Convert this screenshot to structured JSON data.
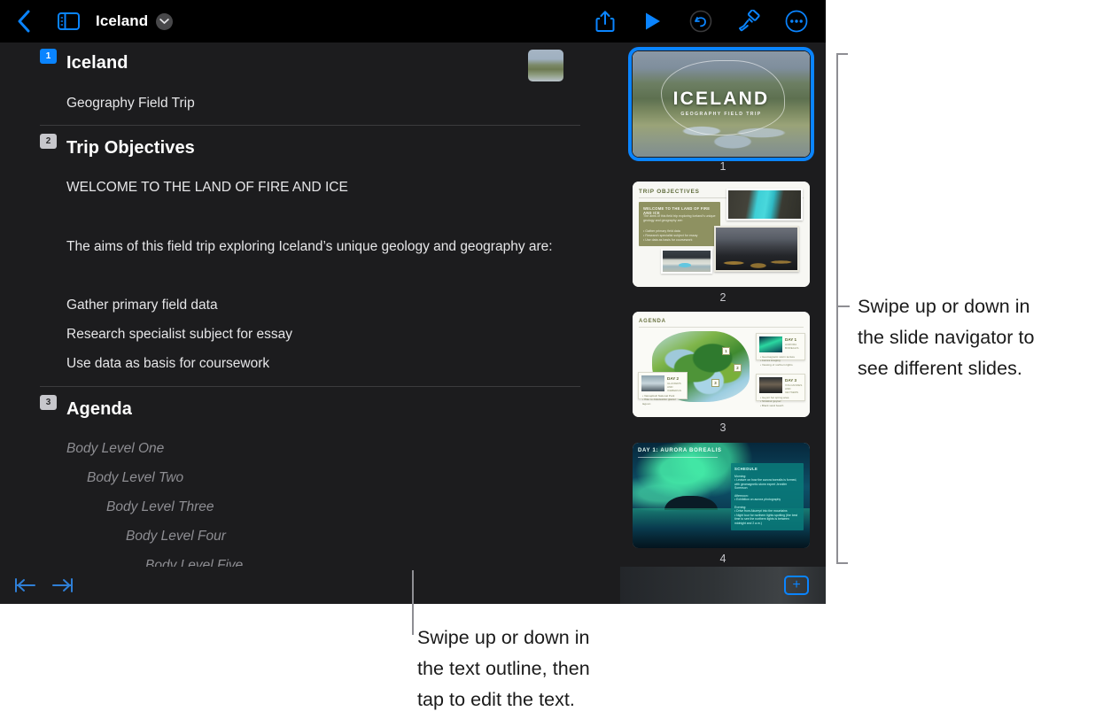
{
  "app": {
    "title": "Iceland",
    "toolbar": {
      "back": "back-chevron",
      "sidebar_toggle": "sidebar-icon",
      "title_menu": "chevron-down-icon",
      "share": "share-icon",
      "play": "play-icon",
      "undo": "undo-icon",
      "format": "paintbrush-icon",
      "more": "more-ellipsis-icon"
    }
  },
  "outline": {
    "slides": [
      {
        "number": "1",
        "selected": true,
        "title": "Iceland",
        "body": [
          "Geography Field Trip"
        ],
        "has_thumbnail": true
      },
      {
        "number": "2",
        "selected": false,
        "title": "Trip Objectives",
        "body": [
          "WELCOME TO THE LAND OF FIRE AND ICE",
          "The aims of this field trip exploring Iceland’s unique geology and geography are:",
          "Gather primary field data",
          "Research specialist subject for essay",
          "Use data as basis for coursework"
        ],
        "has_thumbnail": false
      },
      {
        "number": "3",
        "selected": false,
        "title": "Agenda",
        "placeholders": [
          "Body Level One",
          "Body Level Two",
          "Body Level Three",
          "Body Level Four",
          "Body Level Five"
        ],
        "has_thumbnail": false
      }
    ]
  },
  "navigator": {
    "slides": [
      {
        "number": "1",
        "selected": true,
        "title": "ICELAND",
        "subtitle": "GEOGRAPHY FIELD TRIP"
      },
      {
        "number": "2",
        "selected": false,
        "title": "TRIP OBJECTIVES",
        "block_title": "WELCOME TO THE LAND OF FIRE AND ICE",
        "block_para": "The aims of this field trip exploring Iceland’s unique geology and geography are:",
        "block_list": "• Gather primary field data\n• Research specialist subject for essay\n• Use data as basis for coursework"
      },
      {
        "number": "3",
        "selected": false,
        "title": "AGENDA",
        "pins": [
          "1",
          "2",
          "3"
        ],
        "cards": [
          {
            "day": "DAY 1",
            "sub": "AURORA BOREALIS",
            "list": "• Geomagnetic storm lecture\n• Aurora imaging\n• Viewing of northern lights"
          },
          {
            "day": "DAY 2",
            "sub": "GLACIERS AND ICEBERGS",
            "list": "• Vatnajökull National Park\n• Hike to Jökulsárlón glacier lagoon"
          },
          {
            "day": "DAY 3",
            "sub": "VOLCANOES AND GEYSERS",
            "list": "• Geysir hot spring area\n• Strokkur geyser\n• Black sand beach"
          }
        ]
      },
      {
        "number": "4",
        "selected": false,
        "title": "DAY 1: AURORA BOREALIS",
        "schedule_title": "SCHEDULE",
        "schedule_morning": "Morning:\n• Lecture on how the aurora borealis is formed, with geomagnetic storm expert Jennifer Sorenson",
        "schedule_afternoon": "Afternoon:\n• Exhibition on aurora photography",
        "schedule_evening": "Evening:\n• Drive from Akureyri into the mountains\n• Night tour for northern lights spotting (the best time to see the northern lights is between midnight and 2 a.m.)"
      }
    ]
  },
  "bottom_bar": {
    "outdent": "outdent-icon",
    "indent": "indent-icon",
    "add_slide": "+"
  },
  "callouts": [
    {
      "id": "navigator-callout",
      "text": "Swipe up or down in\nthe slide navigator to\nsee different slides."
    },
    {
      "id": "outline-callout",
      "text": "Swipe up or down in\nthe text outline, then\ntap to edit the text."
    }
  ],
  "colors": {
    "accent": "#0a84ff",
    "window_bg": "#1c1c1e",
    "toolbar_bg": "#000000",
    "page_bg": "#ffffff",
    "callout_line": "#8e8e93",
    "placeholder_text": "#8e8e93"
  }
}
